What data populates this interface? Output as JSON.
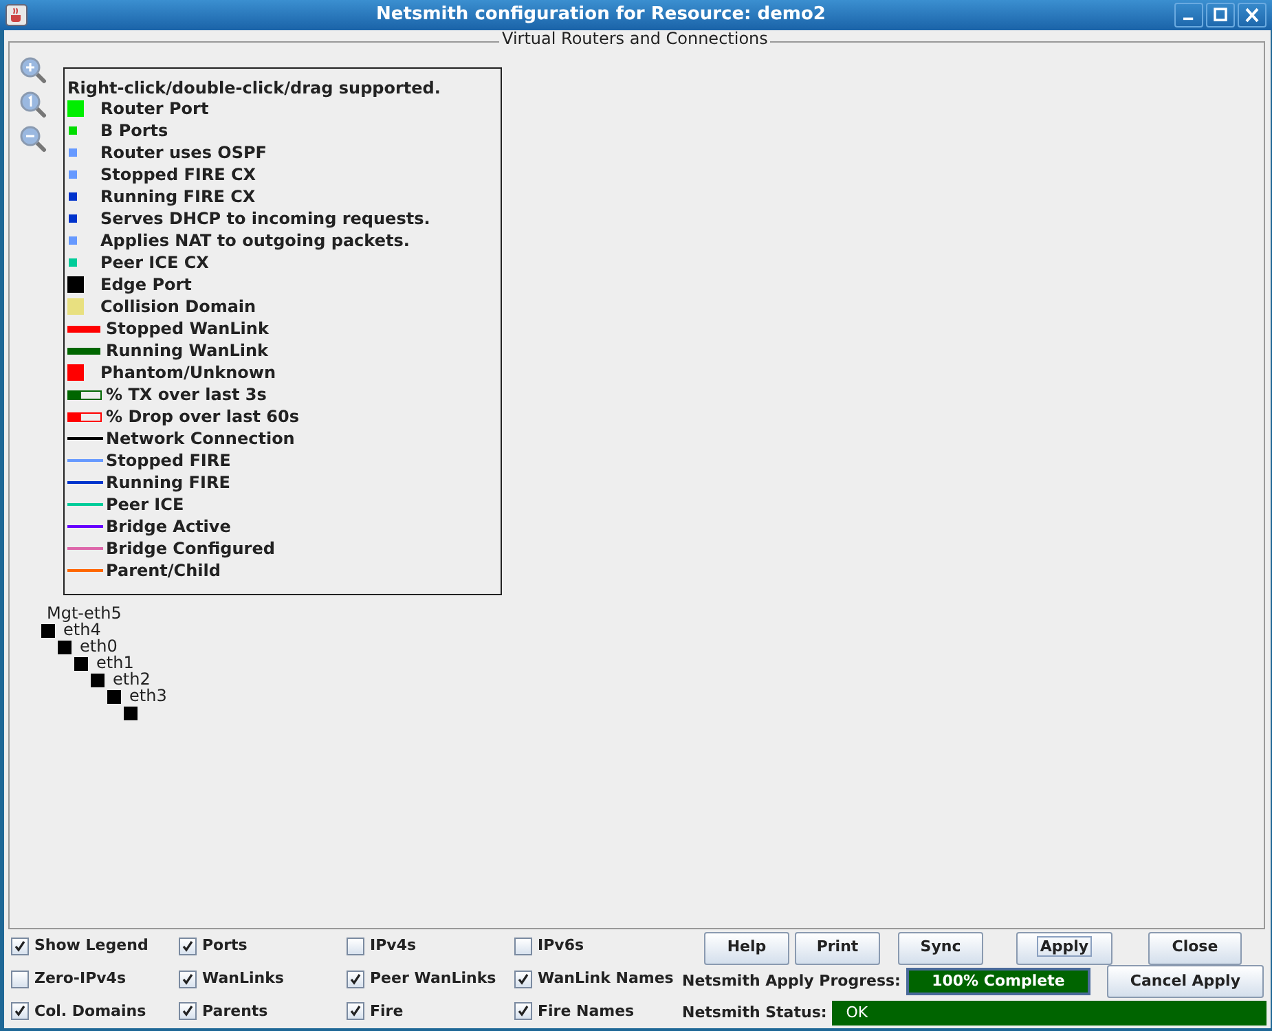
{
  "window": {
    "title": "Netsmith configuration for Resource:  demo2"
  },
  "panel": {
    "title": "Virtual Routers and Connections"
  },
  "zoom_tools": [
    {
      "kind": "zoom-in"
    },
    {
      "kind": "zoom-reset"
    },
    {
      "kind": "zoom-out"
    }
  ],
  "legend": {
    "heading": "Right-click/double-click/drag supported.",
    "items": [
      {
        "kind": "big-square",
        "color": "#00ee00",
        "label": "Router Port"
      },
      {
        "kind": "small-square",
        "color": "#00dd00",
        "label": "B Ports"
      },
      {
        "kind": "small-square",
        "color": "#6699ff",
        "label": "Router uses OSPF"
      },
      {
        "kind": "small-square",
        "color": "#6699ff",
        "label": "Stopped FIRE CX"
      },
      {
        "kind": "small-square",
        "color": "#0033cc",
        "label": "Running FIRE CX"
      },
      {
        "kind": "small-square",
        "color": "#0033cc",
        "label": "Serves DHCP to incoming requests."
      },
      {
        "kind": "small-square",
        "color": "#6699ff",
        "label": "Applies NAT to outgoing packets."
      },
      {
        "kind": "small-square",
        "color": "#00cc99",
        "label": "Peer ICE CX"
      },
      {
        "kind": "big-square",
        "color": "#000000",
        "label": "Edge Port"
      },
      {
        "kind": "big-square",
        "color": "#e8e080",
        "label": "Collision Domain"
      },
      {
        "kind": "bar",
        "color": "#ff0000",
        "label": "Stopped WanLink"
      },
      {
        "kind": "bar",
        "color": "#006600",
        "label": "Running WanLink"
      },
      {
        "kind": "big-square",
        "color": "#ff0000",
        "label": "Phantom/Unknown"
      },
      {
        "kind": "meter",
        "color": "#006600",
        "label": "% TX over last 3s"
      },
      {
        "kind": "meter",
        "color": "#ff0000",
        "label": "% Drop over last 60s"
      },
      {
        "kind": "line",
        "color": "#000000",
        "label": "Network Connection"
      },
      {
        "kind": "line",
        "color": "#6699ff",
        "label": "Stopped FIRE"
      },
      {
        "kind": "line",
        "color": "#0033cc",
        "label": "Running FIRE"
      },
      {
        "kind": "line",
        "color": "#00cc99",
        "label": "Peer ICE"
      },
      {
        "kind": "line",
        "color": "#6600ff",
        "label": "Bridge Active"
      },
      {
        "kind": "line",
        "color": "#dd66aa",
        "label": "Bridge Configured"
      },
      {
        "kind": "line",
        "color": "#ff6600",
        "label": "Parent/Child"
      }
    ]
  },
  "ports": [
    {
      "label": "Mgt-eth5"
    },
    {
      "label": "eth4"
    },
    {
      "label": "eth0"
    },
    {
      "label": "eth1"
    },
    {
      "label": "eth2"
    },
    {
      "label": "eth3"
    }
  ],
  "options": [
    {
      "label": "Show Legend",
      "checked": true
    },
    {
      "label": "Ports",
      "checked": true
    },
    {
      "label": "IPv4s",
      "checked": false
    },
    {
      "label": "IPv6s",
      "checked": false
    },
    {
      "label": "Zero-IPv4s",
      "checked": false
    },
    {
      "label": "WanLinks",
      "checked": true
    },
    {
      "label": "Peer WanLinks",
      "checked": true
    },
    {
      "label": "WanLink Names",
      "checked": true
    },
    {
      "label": "Col. Domains",
      "checked": true
    },
    {
      "label": "Parents",
      "checked": true
    },
    {
      "label": "Fire",
      "checked": true
    },
    {
      "label": "Fire Names",
      "checked": true
    }
  ],
  "buttons": [
    {
      "label": "Help",
      "focused": false
    },
    {
      "label": "Print",
      "focused": false
    },
    {
      "label": "Sync",
      "focused": false
    },
    {
      "label": "Apply",
      "focused": true
    },
    {
      "label": "Close",
      "focused": false
    }
  ],
  "progress": {
    "label": "Netsmith Apply Progress:",
    "text": "100% Complete",
    "level": 1
  },
  "cancel_button": "Cancel Apply",
  "status": {
    "label": "Netsmith Status:",
    "value": "OK"
  }
}
